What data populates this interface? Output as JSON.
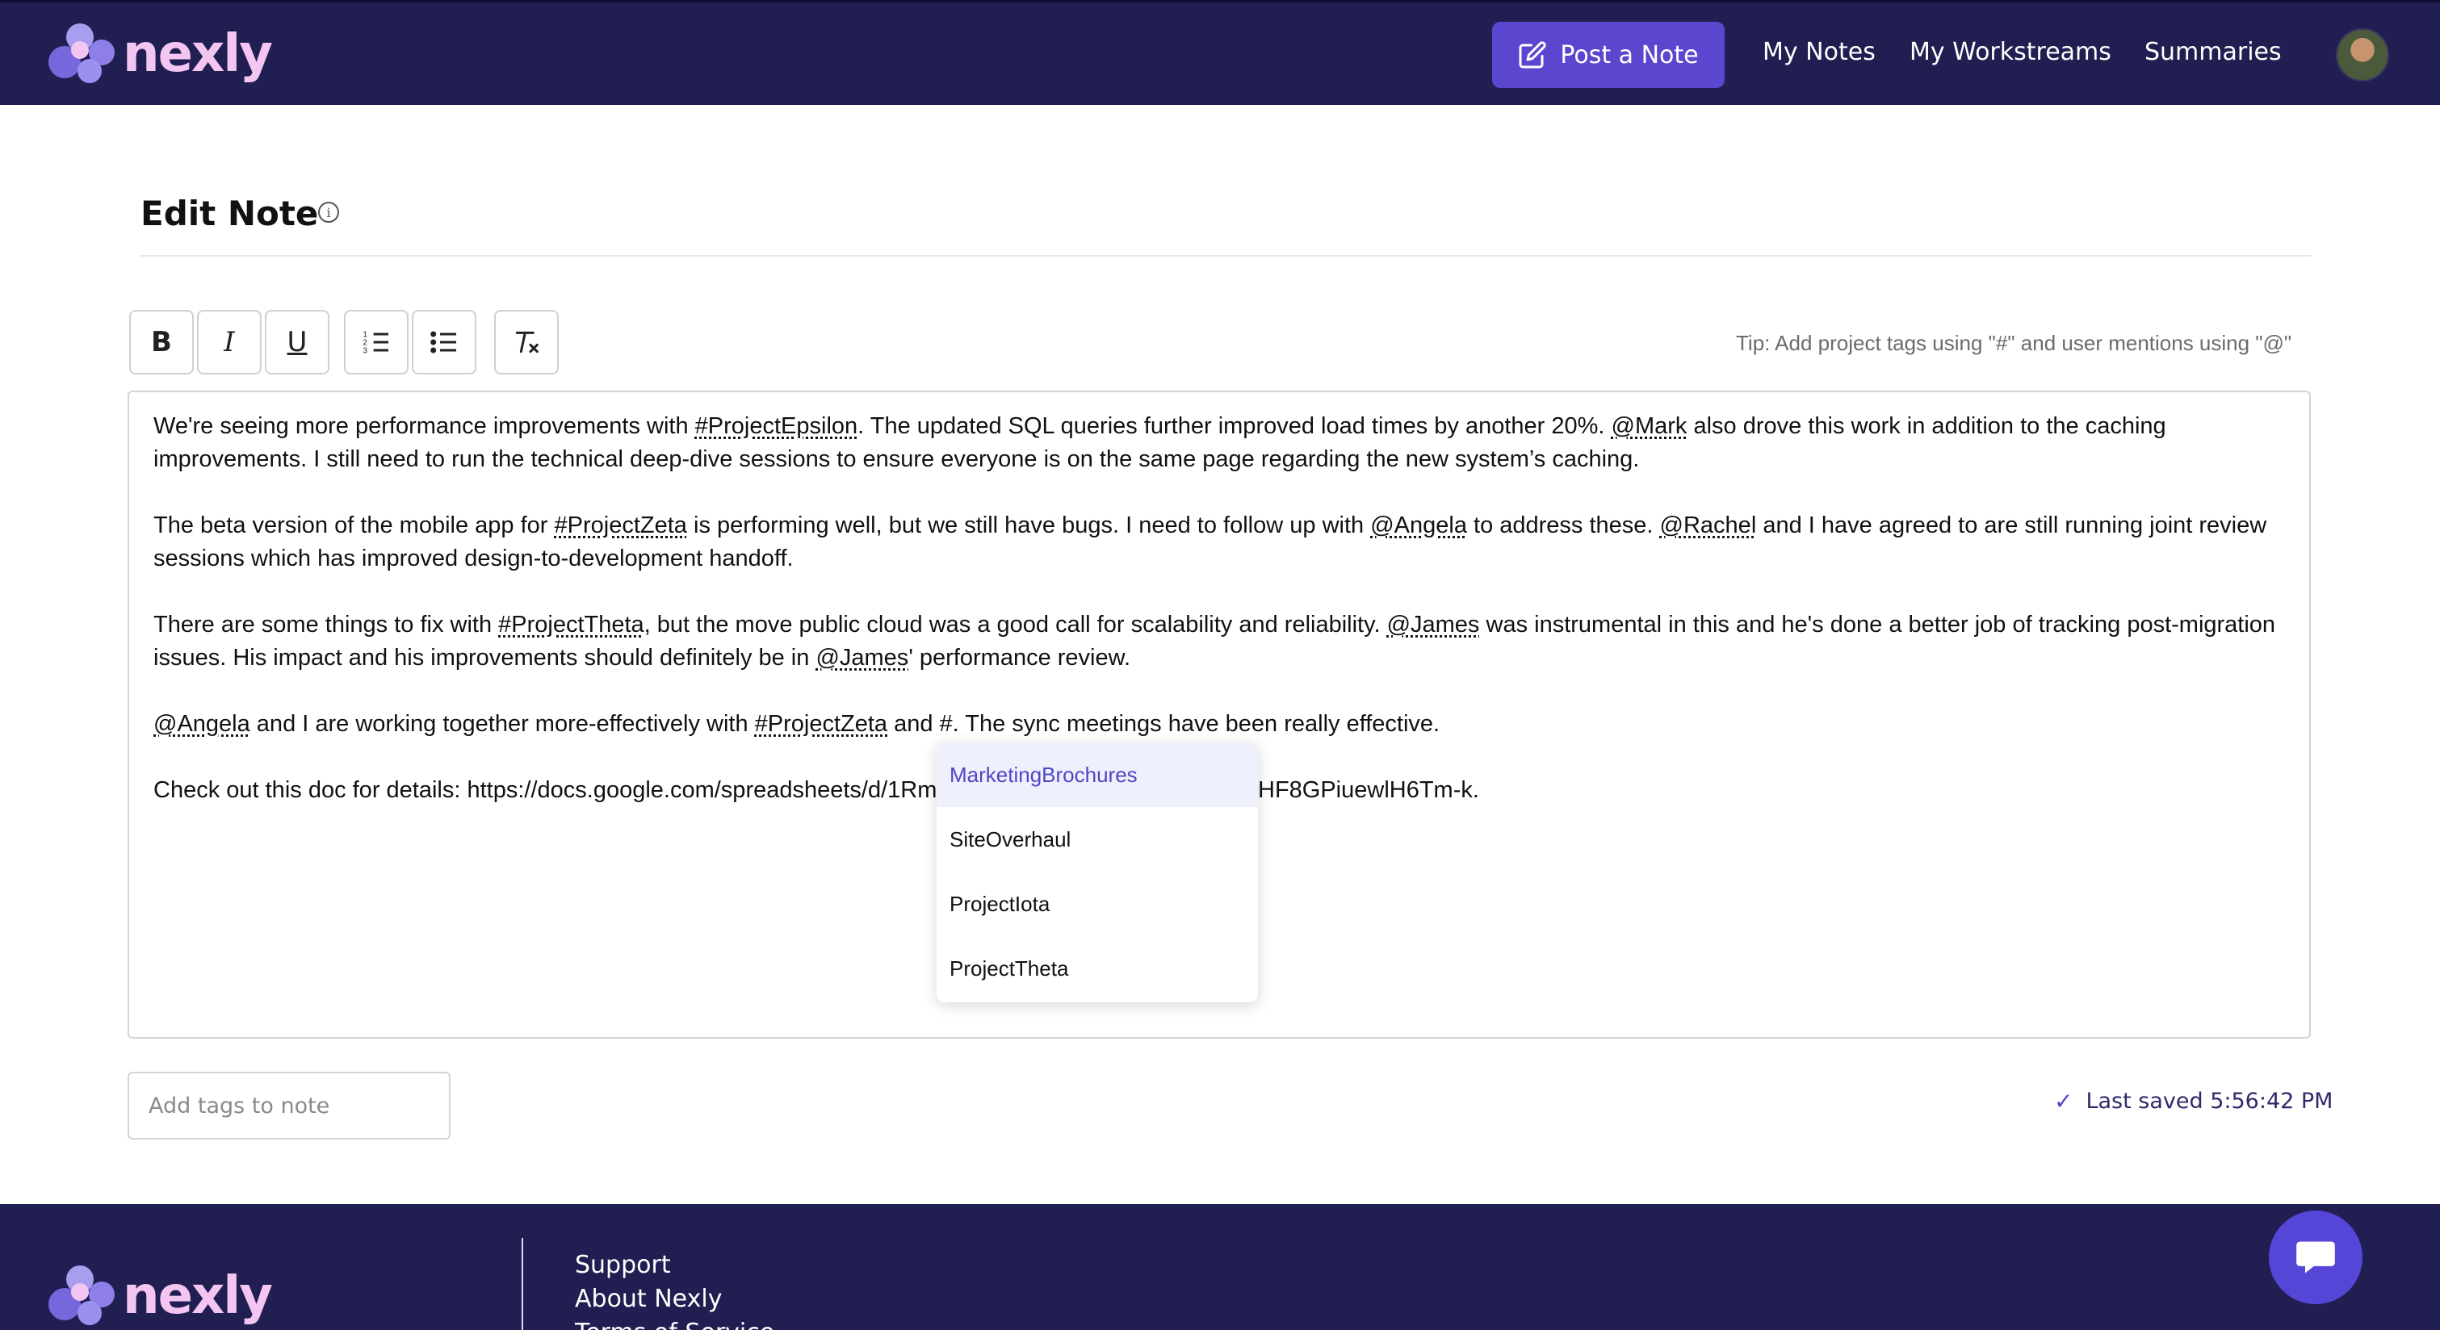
{
  "brand": {
    "name": "nexly"
  },
  "nav": {
    "post_note": "Post a Note",
    "my_notes": "My Notes",
    "my_workstreams": "My Workstreams",
    "summaries": "Summaries"
  },
  "page": {
    "title": "Edit Note"
  },
  "toolbar": {
    "bold": "B",
    "italic": "I",
    "underline": "U",
    "tip": "Tip: Add project tags using \"#\" and user mentions using \"@\""
  },
  "editor": {
    "p1": {
      "a": "We're seeing more performance improvements with ",
      "tag1": "#ProjectEpsilon",
      "b": ". The updated SQL queries further improved load times by another 20%. ",
      "tag2": "@Mark",
      "c": " also drove this work in addition to the caching improvements. I still need to run the technical deep-dive sessions to ensure everyone is on the same page regarding the new system’s caching."
    },
    "p2": {
      "a": "The beta version of the mobile app for ",
      "tag1": "#ProjectZeta",
      "b": " is performing well, but we still have bugs. I need to follow up with ",
      "tag2": "@Angela",
      "c": " to address these. ",
      "tag3": "@Rachel",
      "d": " and I have agreed to are still running joint review sessions which has improved design-to-development handoff."
    },
    "p3": {
      "a": "There are some things to fix with ",
      "tag1": "#ProjectTheta",
      "b": ", but the move public cloud was a good call for scalability and reliability. ",
      "tag2": "@James",
      "c": " was instrumental in this and he's done a better job of tracking post-migration issues. His impact and his improvements should definitely be in ",
      "tag3": "@James",
      "d": "' performance review."
    },
    "p4": {
      "tag1": "@Angela",
      "a": " and I are working together more-effectively with ",
      "tag2": "#ProjectZeta",
      "b": " and #. The sync meetings have been really effective."
    },
    "p5": {
      "a": "Check out this doc for details: https://docs.google.com/spreadsheets/d/1Rmv",
      "b": "HF8GPiuewlH6Tm-k."
    }
  },
  "dropdown": {
    "items": [
      "MarketingBrochures",
      "SiteOverhaul",
      "ProjectIota",
      "ProjectTheta"
    ],
    "selected": "MarketingBrochures"
  },
  "tags_input": {
    "placeholder": "Add tags to note",
    "value": ""
  },
  "status": {
    "last_saved": "Last saved 5:56:42 PM"
  },
  "footer": {
    "links": [
      "Support",
      "About Nexly",
      "Terms of Service"
    ]
  },
  "colors": {
    "nav_bg": "#211e51",
    "accent": "#5a46cf",
    "logo_text": "#f3c6f2"
  }
}
